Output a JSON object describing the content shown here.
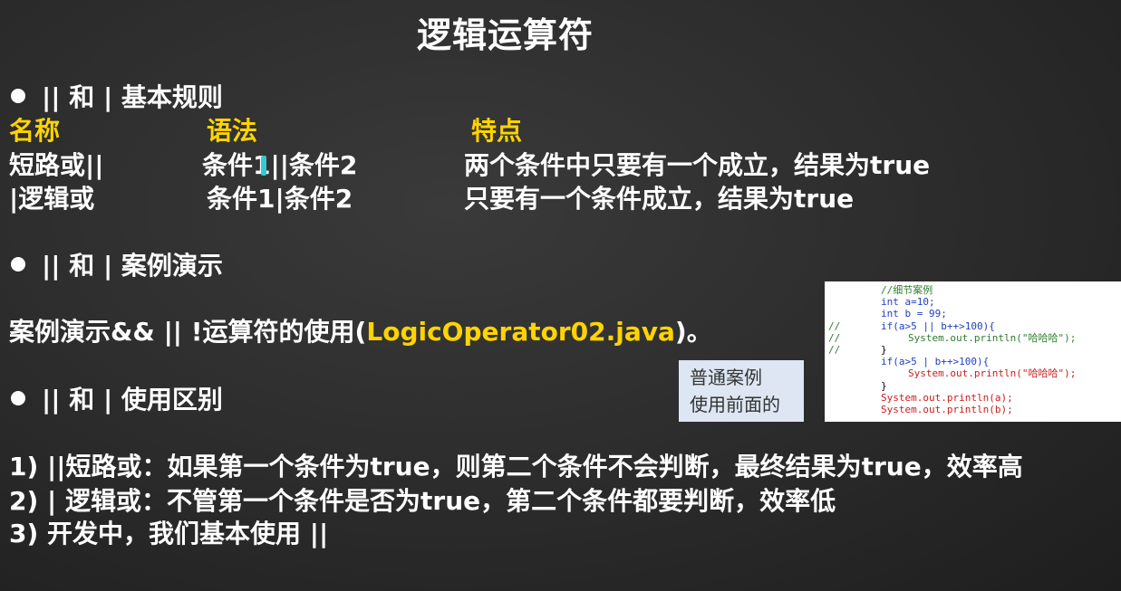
{
  "title": "逻辑运算符",
  "section1": {
    "heading": "|| 和 | 基本规则",
    "col_name": "名称",
    "col_syntax": "语法",
    "col_feature": "特点",
    "rows": [
      {
        "name": "短路或||",
        "syntax": "条件1||条件2",
        "feature": "两个条件中只要有一个成立，结果为true"
      },
      {
        "name": "|逻辑或",
        "syntax": "条件1|条件2",
        "feature": "只要有一个条件成立，结果为true"
      }
    ]
  },
  "section2": {
    "heading": "|| 和 | 案例演示",
    "demo_prefix": "案例演示&& ||  !运算符的使用(",
    "demo_file": "LogicOperator02.java",
    "demo_suffix": ")。"
  },
  "section3": {
    "heading": "|| 和 | 使用区别",
    "points": [
      "1) ||短路或：如果第一个条件为true，则第二个条件不会判断，最终结果为true，效率高",
      "2) | 逻辑或：不管第一个条件是否为true，第二个条件都要判断，效率低",
      "3) 开发中，我们基本使用 ||"
    ]
  },
  "note": {
    "line1": "普通案例",
    "line2": "使用前面的"
  },
  "code": {
    "comment_mark": "//",
    "lines": [
      "//细节案例",
      "int a=10;",
      "int b = 99;",
      "if(a>5 || b++>100){",
      "System.out.println(\"哈哈哈\");",
      "}",
      "if(a>5 | b++>100){",
      "System.out.println(\"哈哈哈\");",
      "}",
      "System.out.println(a);",
      "System.out.println(b);"
    ]
  }
}
